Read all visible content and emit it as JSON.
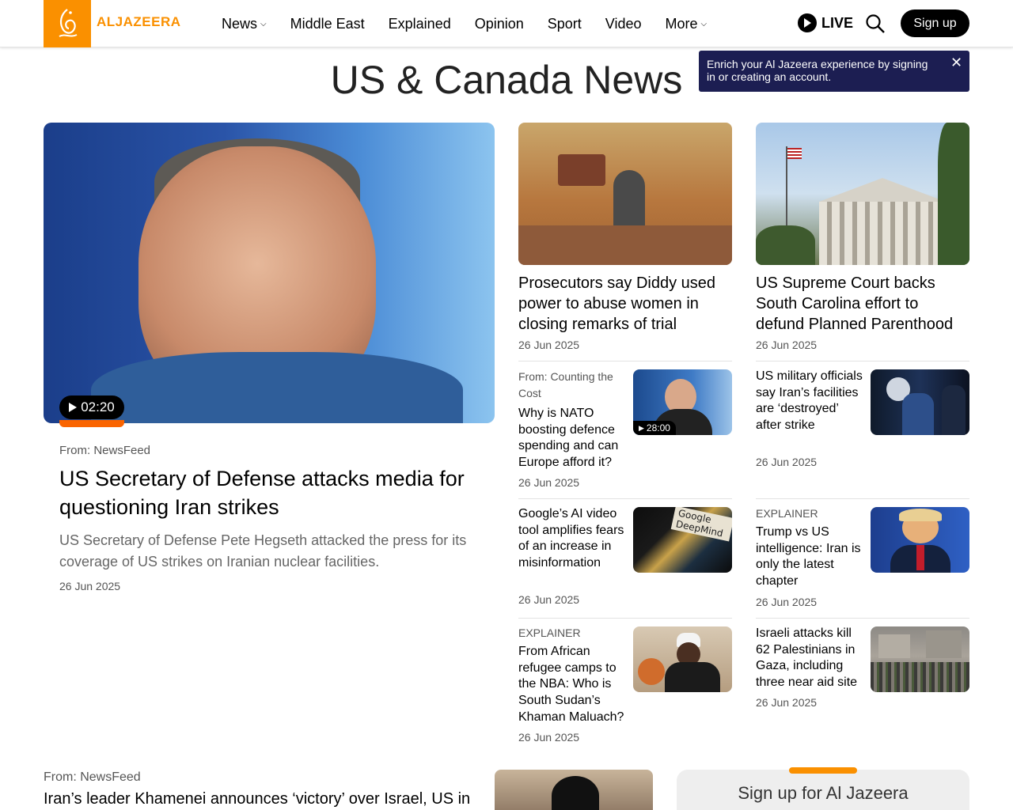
{
  "header": {
    "logo_text": "ALJAZEERA",
    "nav": [
      {
        "label": "News",
        "has_dropdown": true
      },
      {
        "label": "Middle East",
        "has_dropdown": false
      },
      {
        "label": "Explained",
        "has_dropdown": false
      },
      {
        "label": "Opinion",
        "has_dropdown": false
      },
      {
        "label": "Sport",
        "has_dropdown": false
      },
      {
        "label": "Video",
        "has_dropdown": false
      },
      {
        "label": "More",
        "has_dropdown": true
      }
    ],
    "live_label": "LIVE",
    "signup_label": "Sign up"
  },
  "tooltip": {
    "text": "Enrich your Al Jazeera experience by signing in or creating an account."
  },
  "page_title": "US & Canada News",
  "hero": {
    "video_duration": "02:20",
    "source": "From: NewsFeed",
    "title": "US Secretary of Defense attacks media for questioning Iran strikes",
    "description": "US Secretary of Defense Pete Hegseth attacked the press for its coverage of US strikes on Iranian nuclear facilities.",
    "date": "26 Jun 2025"
  },
  "col1": {
    "top": {
      "title": "Prosecutors say Diddy used power to abuse women in closing remarks of trial",
      "date": "26 Jun 2025"
    },
    "items": [
      {
        "label": "From: Counting the Cost",
        "title": "Why is NATO boosting defence spending and can Europe afford it?",
        "date": "26 Jun 2025",
        "duration": "28:00"
      },
      {
        "label": "",
        "title": "Google’s AI video tool amplifies fears of an increase in misinformation",
        "date": "26 Jun 2025"
      },
      {
        "label": "EXPLAINER",
        "title": "From African refugee camps to the NBA: Who is South Sudan’s Khaman Maluach?",
        "date": "26 Jun 2025"
      }
    ]
  },
  "col2": {
    "top": {
      "title": "US Supreme Court backs South Carolina effort to defund Planned Parenthood",
      "date": "26 Jun 2025"
    },
    "items": [
      {
        "label": "",
        "title": "US military officials say Iran’s facilities are ‘destroyed’ after strike",
        "date": "26 Jun 2025"
      },
      {
        "label": "EXPLAINER",
        "title": "Trump vs US intelligence: Iran is only the latest chapter",
        "date": "26 Jun 2025"
      },
      {
        "label": "",
        "title": "Israeli attacks kill 62 Palestinians in Gaza, including three near aid site",
        "date": "26 Jun 2025"
      }
    ]
  },
  "bottom": {
    "source": "From: NewsFeed",
    "title": "Iran’s leader Khamenei announces ‘victory’ over Israel, US in",
    "signup_title": "Sign up for Al Jazeera"
  },
  "colors": {
    "brand_orange": "#fa9000",
    "tooltip_bg": "#1c1e52",
    "video_accent": "#fa6400"
  },
  "icons": {
    "logo": "aljazeera-calligraphy-icon",
    "live": "play-circle-icon",
    "search": "search-icon",
    "close": "close-icon"
  }
}
